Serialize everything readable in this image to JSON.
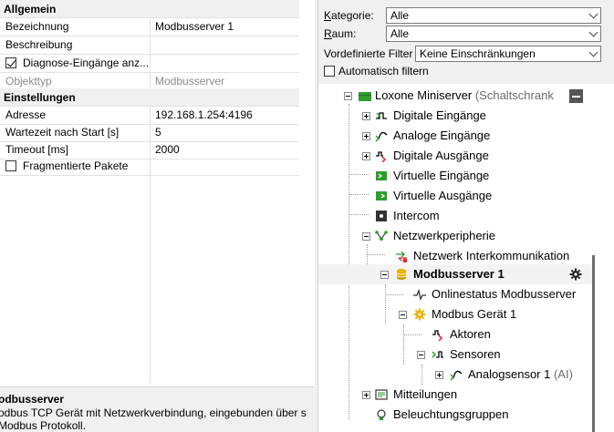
{
  "properties": {
    "section_general": "Allgemein",
    "rows_general": [
      {
        "key": "Bezeichnung",
        "value": "Modbusserver 1"
      },
      {
        "key": "Beschreibung",
        "value": ""
      },
      {
        "key": "Diagnose-Eingänge anz...",
        "value": "",
        "checked": true
      },
      {
        "key": "Objekttyp",
        "value": "Modbusserver",
        "readonly": true
      }
    ],
    "section_settings": "Einstellungen",
    "rows_settings": [
      {
        "key": "Adresse",
        "value": "192.168.1.254:4196"
      },
      {
        "key": "Wartezeit nach Start [s]",
        "value": "5"
      },
      {
        "key": "Timeout [ms]",
        "value": "2000"
      },
      {
        "key": "Fragmentierte Pakete",
        "value": "",
        "checked": false
      }
    ]
  },
  "description": {
    "title": "odbusserver",
    "text": "odbus TCP Gerät mit Netzwerkverbindung, eingebunden über s Modbus Protokoll."
  },
  "filters": {
    "category_label_u": "K",
    "category_label_rest": "ategorie:",
    "category_value": "Alle",
    "room_label_u": "R",
    "room_label_rest": "aum:",
    "room_value": "Alle",
    "predefined_label": "Vordefinierte Filter",
    "predefined_value": "Keine Einschränkungen",
    "auto_filter_label": "Automatisch filtern",
    "auto_filter_checked": false
  },
  "tree": {
    "miniserver": "Loxone Miniserver",
    "miniserver_suffix": "(Schaltschrank",
    "digital_inputs": "Digitale Eingänge",
    "analog_inputs": "Analoge Eingänge",
    "digital_outputs": "Digitale Ausgänge",
    "virtual_inputs": "Virtuelle Eingänge",
    "virtual_outputs": "Virtuelle Ausgänge",
    "intercom": "Intercom",
    "network_periphery": "Netzwerkperipherie",
    "network_intercom": "Netzwerk Interkommunikation",
    "modbus_server": "Modbusserver 1",
    "online_status": "Onlinestatus Modbusserver",
    "modbus_device": "Modbus Gerät 1",
    "actuators": "Aktoren",
    "sensors": "Sensoren",
    "analog_sensor": "Analogsensor 1",
    "analog_sensor_suffix": "(AI)",
    "messages": "Mitteilungen",
    "lighting_groups": "Beleuchtungsgruppen"
  },
  "colors": {
    "accent_green": "#2e9e2e",
    "error_red": "#e0262f",
    "db_yellow": "#e8b400"
  }
}
